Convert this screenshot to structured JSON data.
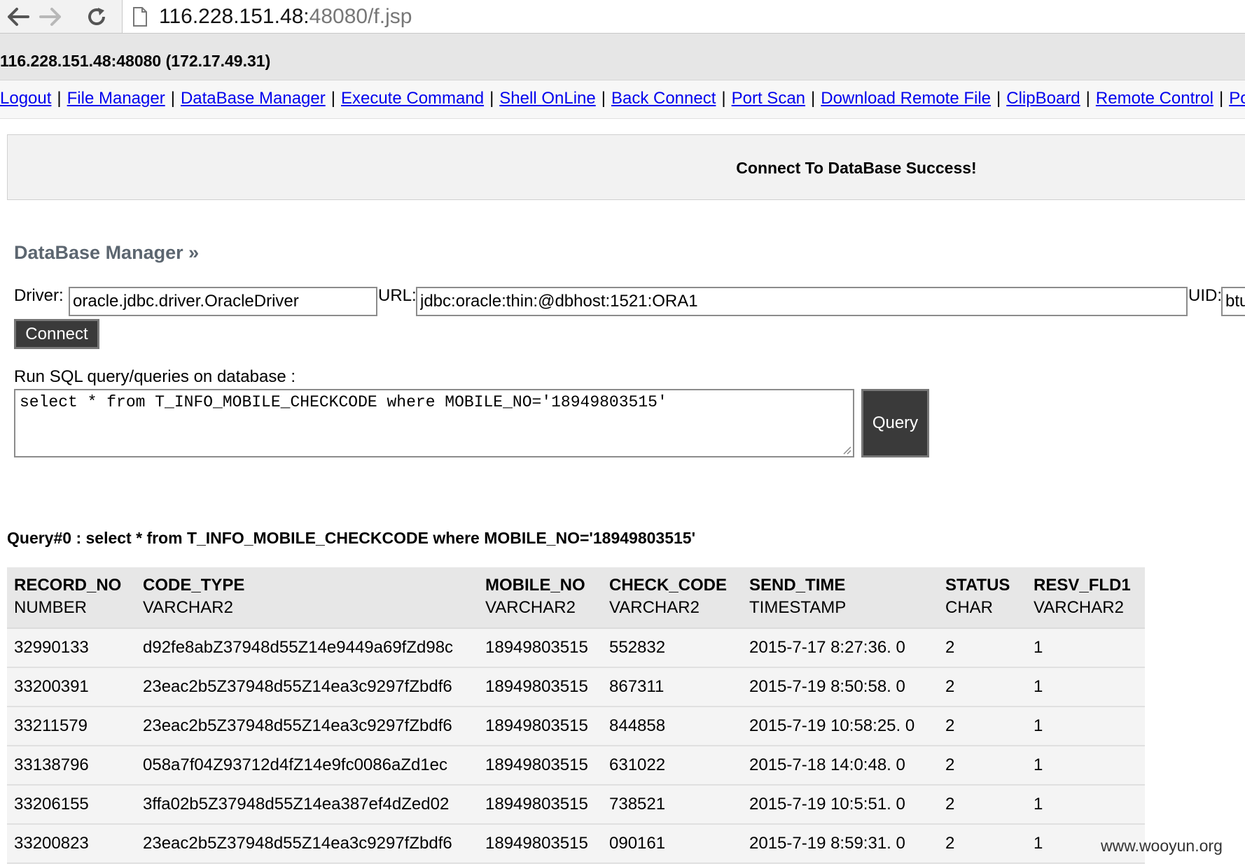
{
  "browser": {
    "url_host": "116.228.151.48:",
    "url_path": "48080/f.jsp"
  },
  "host_info": "116.228.151.48:48080 (172.17.49.31)",
  "menu": [
    "Logout",
    "File Manager",
    "DataBase Manager",
    "Execute Command",
    "Shell OnLine",
    "Back Connect",
    "Port Scan",
    "Download Remote File",
    "ClipBoard",
    "Remote Control",
    "Port"
  ],
  "separator": "|",
  "status_message": "Connect To DataBase Success!",
  "db_manager": {
    "title": "DataBase Manager »",
    "driver_label": "Driver:",
    "driver_value": "oracle.jdbc.driver.OracleDriver",
    "url_label": "URL:",
    "url_value": "jdbc:oracle:thin:@dbhost:1521:ORA1",
    "uid_label": "UID:",
    "uid_value": "btu",
    "connect_label": "Connect",
    "sql_label": "Run SQL query/queries on database :",
    "sql_value": "select * from T_INFO_MOBILE_CHECKCODE where MOBILE_NO='18949803515'",
    "query_label": "Query"
  },
  "result": {
    "title": "Query#0 : select * from T_INFO_MOBILE_CHECKCODE where MOBILE_NO='18949803515'",
    "columns": [
      {
        "name": "RECORD_NO",
        "type": "NUMBER"
      },
      {
        "name": "CODE_TYPE",
        "type": "VARCHAR2"
      },
      {
        "name": "MOBILE_NO",
        "type": "VARCHAR2"
      },
      {
        "name": "CHECK_CODE",
        "type": "VARCHAR2"
      },
      {
        "name": "SEND_TIME",
        "type": "TIMESTAMP"
      },
      {
        "name": "STATUS",
        "type": "CHAR"
      },
      {
        "name": "RESV_FLD1",
        "type": "VARCHAR2"
      }
    ],
    "rows": [
      [
        "32990133",
        "d92fe8abZ37948d55Z14e9449a69fZd98c",
        "18949803515",
        "552832",
        "2015-7-17 8:27:36. 0",
        "2",
        "1"
      ],
      [
        "33200391",
        "23eac2b5Z37948d55Z14ea3c9297fZbdf6",
        "18949803515",
        "867311",
        "2015-7-19 8:50:58. 0",
        "2",
        "1"
      ],
      [
        "33211579",
        "23eac2b5Z37948d55Z14ea3c9297fZbdf6",
        "18949803515",
        "844858",
        "2015-7-19 10:58:25. 0",
        "2",
        "1"
      ],
      [
        "33138796",
        "058a7f04Z93712d4fZ14e9fc0086aZd1ec",
        "18949803515",
        "631022",
        "2015-7-18 14:0:48. 0",
        "2",
        "1"
      ],
      [
        "33206155",
        "3ffa02b5Z37948d55Z14ea387ef4dZed02",
        "18949803515",
        "738521",
        "2015-7-19 10:5:51. 0",
        "2",
        "1"
      ],
      [
        "33200823",
        "23eac2b5Z37948d55Z14ea3c9297fZbdf6",
        "18949803515",
        "090161",
        "2015-7-19 8:59:31. 0",
        "2",
        "1"
      ]
    ]
  },
  "watermark": "www.wooyun.org"
}
